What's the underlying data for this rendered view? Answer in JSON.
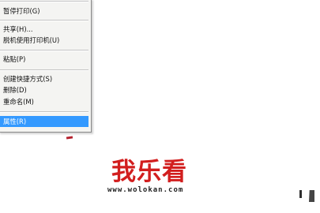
{
  "context_menu": {
    "items": [
      {
        "label": "暂停打印(G)",
        "highlighted": false
      },
      {
        "label": "共享(H)...",
        "highlighted": false
      },
      {
        "label": "脱机使用打印机(U)",
        "highlighted": false
      },
      {
        "label": "粘贴(P)",
        "highlighted": false
      },
      {
        "label": "创建快捷方式(S)",
        "highlighted": false
      },
      {
        "label": "删除(D)",
        "highlighted": false
      },
      {
        "label": "重命名(M)",
        "highlighted": false
      },
      {
        "label": "属性(R)",
        "highlighted": true
      }
    ],
    "highlight_color": "#3399ff"
  },
  "watermark": {
    "brand": "我乐看",
    "url": "www.wolokan.com",
    "brand_color": "#d21e1e"
  }
}
